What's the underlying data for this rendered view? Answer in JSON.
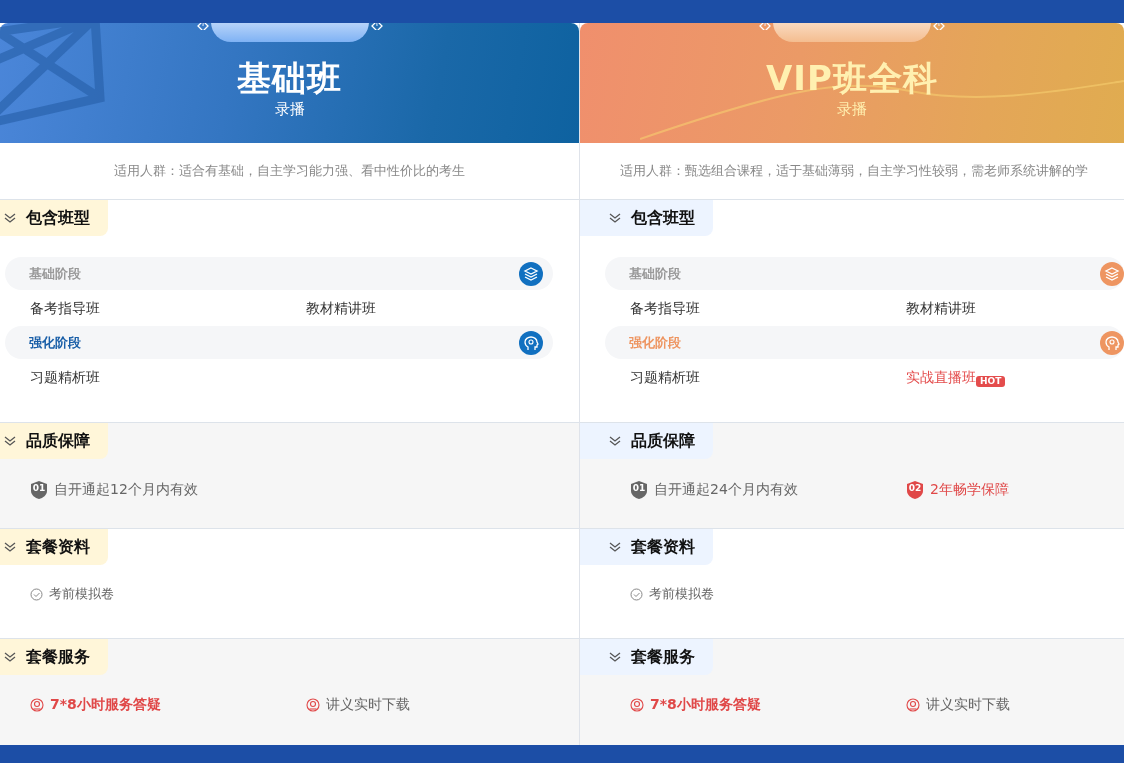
{
  "cards": [
    {
      "title": "基础班",
      "subtitle": "录播",
      "audience": "适用人群：适合有基础，自主学习能力强、看中性价比的考生",
      "sections": [
        {
          "kind": "classes",
          "heading": "包含班型",
          "stages": [
            {
              "name": "基础阶段",
              "highlighted": false,
              "items": [
                {
                  "label": "备考指导班",
                  "highlighted": false
                },
                {
                  "label": "教材精讲班",
                  "highlighted": false
                }
              ]
            },
            {
              "name": "强化阶段",
              "highlighted": true,
              "items": [
                {
                  "label": "习题精析班",
                  "highlighted": false
                }
              ]
            }
          ]
        },
        {
          "kind": "guarantees",
          "heading": "品质保障",
          "items": [
            {
              "number": "01",
              "label": "自开通起12个月内有效",
              "highlighted": false
            }
          ]
        },
        {
          "kind": "materials",
          "heading": "套餐资料",
          "items": [
            {
              "label": "考前模拟卷"
            }
          ]
        },
        {
          "kind": "services",
          "heading": "套餐服务",
          "items": [
            {
              "label": "7*8小时服务答疑",
              "highlighted": true
            },
            {
              "label": "讲义实时下载",
              "highlighted": false
            }
          ]
        }
      ]
    },
    {
      "title": "VIP班全科",
      "subtitle": "录播",
      "audience": "适用人群：甄选组合课程，适于基础薄弱，自主学习性较弱，需老师系统讲解的学",
      "sections": [
        {
          "kind": "classes",
          "heading": "包含班型",
          "stages": [
            {
              "name": "基础阶段",
              "highlighted": false,
              "items": [
                {
                  "label": "备考指导班",
                  "highlighted": false
                },
                {
                  "label": "教材精讲班",
                  "highlighted": false
                }
              ]
            },
            {
              "name": "强化阶段",
              "highlighted": true,
              "items": [
                {
                  "label": "习题精析班",
                  "highlighted": false
                },
                {
                  "label": "实战直播班",
                  "highlighted": true,
                  "badge": "HOT"
                }
              ]
            }
          ]
        },
        {
          "kind": "guarantees",
          "heading": "品质保障",
          "items": [
            {
              "number": "01",
              "label": "自开通起24个月内有效",
              "highlighted": false
            },
            {
              "number": "02",
              "label": "2年畅学保障",
              "highlighted": true
            }
          ]
        },
        {
          "kind": "materials",
          "heading": "套餐资料",
          "items": [
            {
              "label": "考前模拟卷"
            }
          ]
        },
        {
          "kind": "services",
          "heading": "套餐服务",
          "items": [
            {
              "label": "7*8小时服务答疑",
              "highlighted": true
            },
            {
              "label": "讲义实时下载",
              "highlighted": false
            }
          ]
        }
      ]
    }
  ]
}
